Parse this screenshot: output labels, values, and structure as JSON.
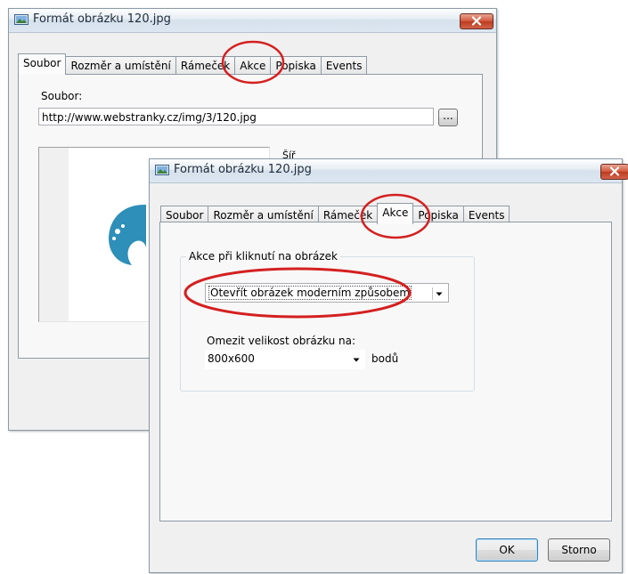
{
  "back_window": {
    "title": "Formát obrázku 120.jpg",
    "tabs": [
      {
        "label": "Soubor",
        "active": true
      },
      {
        "label": "Rozměr a umístění",
        "active": false
      },
      {
        "label": "Rámeček",
        "active": false
      },
      {
        "label": "Akce",
        "active": false
      },
      {
        "label": "Popiska",
        "active": false
      },
      {
        "label": "Events",
        "active": false
      }
    ],
    "file_label": "Soubor:",
    "file_value": "http://www.webstranky.cz/img/3/120.jpg",
    "browse_label": "...",
    "partial_label": "Šíř"
  },
  "front_window": {
    "title": "Formát obrázku 120.jpg",
    "tabs": [
      {
        "label": "Soubor",
        "active": false
      },
      {
        "label": "Rozměr a umístění",
        "active": false
      },
      {
        "label": "Rámeček",
        "active": false
      },
      {
        "label": "Akce",
        "active": true
      },
      {
        "label": "Popiska",
        "active": false
      },
      {
        "label": "Events",
        "active": false
      }
    ],
    "group_title": "Akce při kliknutí na obrázek",
    "action_value": "Otevřít obrázek moderním způsobem",
    "limit_label": "Omezit velikost obrázku na:",
    "size_value": "800x600",
    "units_label": "bodů",
    "ok_label": "OK",
    "cancel_label": "Storno"
  },
  "colors": {
    "annotation": "#d42020",
    "logo_blue": "#2e8fb8"
  }
}
